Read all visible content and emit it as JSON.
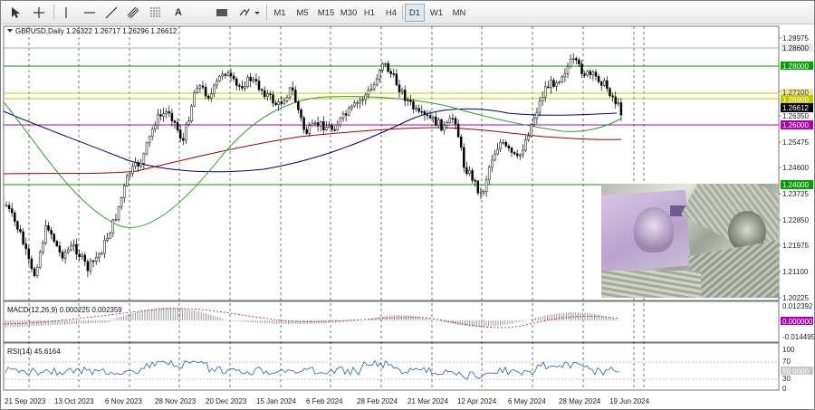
{
  "toolbar": {
    "timeframes": [
      "M1",
      "M5",
      "M15",
      "M30",
      "H1",
      "H4",
      "D1",
      "W1",
      "MN"
    ],
    "active_timeframe": "D1",
    "tool_a_label": "A"
  },
  "chart": {
    "symbol_line": "GBPUSD,Daily  1.26322 1.26717 1.26296 1.26612",
    "price_axis": [
      "1.28975",
      "1.28600",
      "1.28000",
      "1.27100",
      "1.26900",
      "1.26612",
      "1.26350",
      "1.26000",
      "1.25475",
      "1.24600",
      "1.24000",
      "1.23725",
      "1.22850",
      "1.21975",
      "1.21100",
      "1.20225"
    ],
    "tags": {
      "t1": "1.28600",
      "t2": "1.28000",
      "t3": "1.27100",
      "t4": "1.26900",
      "t5": "1.26612",
      "t6": "1.26000",
      "t7": "1.24000"
    },
    "date_axis": [
      "21 Sep 2023",
      "13 Oct 2023",
      "6 Nov 2023",
      "28 Nov 2023",
      "20 Dec 2023",
      "15 Jan 2024",
      "6 Feb 2024",
      "28 Feb 2024",
      "21 Mar 2024",
      "12 Apr 2024",
      "6 May 2024",
      "28 May 2024",
      "19 Jun 2024"
    ],
    "colors": {
      "green_level": "#00a000",
      "red_level": "#c01020",
      "magenta_level": "#b000b0",
      "yellow_level": "#c8c800",
      "ma_blue": "#000080",
      "ma_red": "#a00000",
      "ma_green": "#2aa02a",
      "rsi": "#2060c0"
    }
  },
  "macd": {
    "title": "MACD(12,26,9) 0.000225 0.002359",
    "axis": [
      "0.012392",
      "0.000000",
      "-0.014495"
    ]
  },
  "rsi": {
    "title": "RSI(14) 45.6164",
    "axis": [
      "100",
      "70",
      "50.0000",
      "30",
      "0"
    ]
  }
}
